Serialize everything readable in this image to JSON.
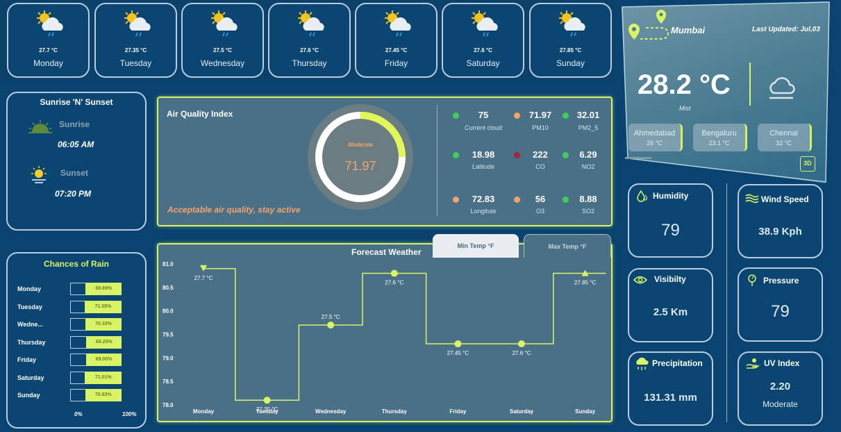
{
  "days": [
    {
      "name": "Monday",
      "temp": "27.7 °C"
    },
    {
      "name": "Tuesday",
      "temp": "27.35 °C"
    },
    {
      "name": "Wednesday",
      "temp": "27.5 °C"
    },
    {
      "name": "Thursday",
      "temp": "27.6 °C"
    },
    {
      "name": "Friday",
      "temp": "27.45 °C"
    },
    {
      "name": "Saturday",
      "temp": "27.6 °C"
    },
    {
      "name": "Sunday",
      "temp": "27.85 °C"
    }
  ],
  "current": {
    "city": "Mumbai",
    "last_updated": "Last Updated: Jul,03",
    "temp": "28.2 °C",
    "condition": "Mist",
    "badge": "3D",
    "other_cities": [
      {
        "name": "Ahmedabad",
        "temp": "26 °C"
      },
      {
        "name": "Bengaluru",
        "temp": "23.1 °C"
      },
      {
        "name": "Chennai",
        "temp": "32 °C"
      }
    ]
  },
  "sun": {
    "title": "Sunrise 'N' Sunset",
    "sunrise_label": "Sunrise",
    "sunrise_time": "06:05 AM",
    "sunset_label": "Sunset",
    "sunset_time": "07:20 PM"
  },
  "aqi": {
    "title": "Air Quality Index",
    "gauge_label": "Moderate",
    "value": "71.97",
    "gauge_fraction": 0.25,
    "message": "Acceptable air quality, stay active",
    "metrics": [
      {
        "value": "75",
        "label": "Current cloud",
        "color": "#3fcf55"
      },
      {
        "value": "71.97",
        "label": "PM10",
        "color": "#f4a36a"
      },
      {
        "value": "32.01",
        "label": "PM2_5",
        "color": "#3fcf55"
      },
      {
        "value": "18.98",
        "label": "Latitude",
        "color": "#3fcf55"
      },
      {
        "value": "222",
        "label": "CO",
        "color": "#a3263a"
      },
      {
        "value": "6.29",
        "label": "NO2",
        "color": "#3fcf55"
      },
      {
        "value": "72.83",
        "label": "Longitute",
        "color": "#f4a36a"
      },
      {
        "value": "56",
        "label": "O3",
        "color": "#f4a36a"
      },
      {
        "value": "8.88",
        "label": "SO2",
        "color": "#3fcf55"
      }
    ]
  },
  "rain": {
    "title": "Chances of Rain",
    "axis_min": "0%",
    "axis_max": "100%",
    "rows": [
      {
        "day": "Monday",
        "pct": "69.69%",
        "value": 69.69
      },
      {
        "day": "Tuesday",
        "pct": "71.55%",
        "value": 71.55
      },
      {
        "day": "Wedne...",
        "pct": "70.33%",
        "value": 70.33
      },
      {
        "day": "Thursday",
        "pct": "68.25%",
        "value": 68.25
      },
      {
        "day": "Friday",
        "pct": "69.00%",
        "value": 69.0
      },
      {
        "day": "Saturday",
        "pct": "71.01%",
        "value": 71.01
      },
      {
        "day": "Sunday",
        "pct": "70.83%",
        "value": 70.83
      }
    ]
  },
  "forecast": {
    "title": "Forecast Weather",
    "tab_min": "Min Temp °F",
    "tab_max": "Max Temp °F"
  },
  "chart_data": {
    "type": "line",
    "title": "Forecast Weather",
    "categories": [
      "Monday",
      "Tuesday",
      "Wednesday",
      "Thursday",
      "Friday",
      "Saturday",
      "Sunday"
    ],
    "values": [
      80.9,
      78.1,
      79.7,
      80.8,
      79.3,
      79.3,
      80.8
    ],
    "point_labels": [
      "27.7 °C",
      "27.35 °C",
      "27.5 °C",
      "27.6 °C",
      "27.45 °C",
      "27.6 °C",
      "27.85 °C"
    ],
    "yticks": [
      "81.0",
      "80.5",
      "80.0",
      "79.5",
      "79.0",
      "78.5",
      "78.0"
    ],
    "ylim": [
      78.0,
      81.0
    ],
    "line_style": "step",
    "color": "#d8f466"
  },
  "stats": {
    "humidity": {
      "title": "Humidity",
      "value": "79"
    },
    "wind": {
      "title": "Wind Speed",
      "value": "38.9 Kph"
    },
    "visibility": {
      "title": "Visibilty",
      "value": "2.5 Km"
    },
    "pressure": {
      "title": "Pressure",
      "value": "79"
    },
    "precip": {
      "title": "Precipitation",
      "value": "131.31 mm"
    },
    "uv": {
      "title": "UV Index",
      "value": "2.20",
      "level": "Moderate"
    }
  }
}
